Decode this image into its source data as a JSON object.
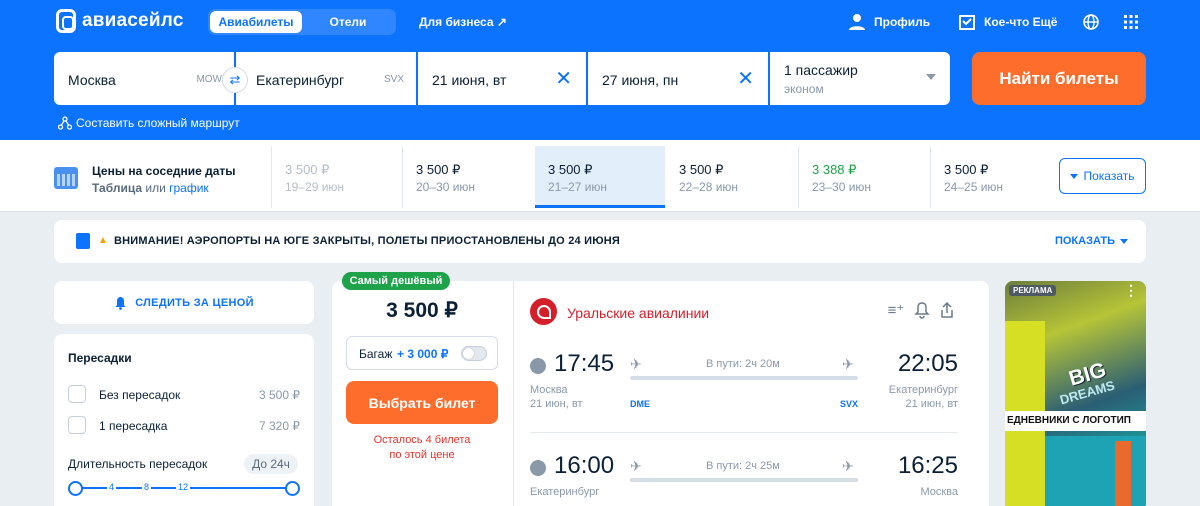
{
  "header": {
    "logo": "авиасейлс",
    "tabs": [
      "Авиабилеты",
      "Отели"
    ],
    "business": "Для бизнеса ↗",
    "profile": "Профиль",
    "extra": "Кое-что Ещё"
  },
  "search": {
    "from": "Москва",
    "from_code": "MOW",
    "to": "Екатеринбург",
    "to_code": "SVX",
    "depart": "21 июня, вт",
    "return": "27 июня, пн",
    "passengers": "1 пассажир",
    "class": "эконом",
    "find_label": "Найти билеты",
    "complex_route": "Составить сложный маршрут"
  },
  "dates_bar": {
    "title": "Цены на соседние даты",
    "sub_table": "Таблица",
    "sub_or": "или",
    "sub_chart": "график",
    "cells": [
      {
        "price": "3 500 ₽",
        "range": "19–29 июн"
      },
      {
        "price": "3 500 ₽",
        "range": "20–30 июн"
      },
      {
        "price": "3 500 ₽",
        "range": "21–27 июн"
      },
      {
        "price": "3 500 ₽",
        "range": "22–28 июн"
      },
      {
        "price": "3 388 ₽",
        "range": "23–30 июн"
      },
      {
        "price": "3 500 ₽",
        "range": "24–25 июн"
      }
    ],
    "show_label": "Показать"
  },
  "alert": {
    "text": "ВНИМАНИЕ! АЭРОПОРТЫ НА ЮГЕ ЗАКРЫТЫ, ПОЛЕТЫ ПРИОСТАНОВЛЕНЫ ДО 24 ИЮНЯ",
    "show": "ПОКАЗАТЬ"
  },
  "filters": {
    "track": "СЛЕДИТЬ ЗА ЦЕНОЙ",
    "transfers_title": "Пересадки",
    "options": [
      {
        "label": "Без пересадок",
        "price": "3 500 ₽"
      },
      {
        "label": "1 пересадка",
        "price": "7 320 ₽"
      }
    ],
    "duration_title": "Длительность пересадок",
    "duration_value": "До 24ч",
    "ticks": [
      "4",
      "8",
      "12"
    ]
  },
  "ticket": {
    "badge": "Самый дешёвый",
    "price": "3 500 ₽",
    "baggage_label": "Багаж",
    "baggage_add": "+ 3 000 ₽",
    "choose": "Выбрать билет",
    "left_line1": "Осталось 4 билета",
    "left_line2": "по этой цене",
    "airline": "Уральские авиалинии",
    "segments": [
      {
        "dep_time": "17:45",
        "arr_time": "22:05",
        "duration": "В пути: 2ч 20м",
        "dep_city": "Москва",
        "arr_city": "Екатеринбург",
        "dep_date": "21 июн, вт",
        "arr_date": "21 июн, вт",
        "dep_iata": "DME",
        "arr_iata": "SVX"
      },
      {
        "dep_time": "16:00",
        "arr_time": "16:25",
        "duration": "В пути: 2ч 25м",
        "dep_city": "Екатеринбург",
        "arr_city": "Москва"
      }
    ]
  },
  "ad": {
    "tag": "РЕКЛАМА",
    "big": "BIG",
    "big2": "DREAMS",
    "strip": "ЕДНЕВНИКИ С ЛОГОТИП"
  }
}
